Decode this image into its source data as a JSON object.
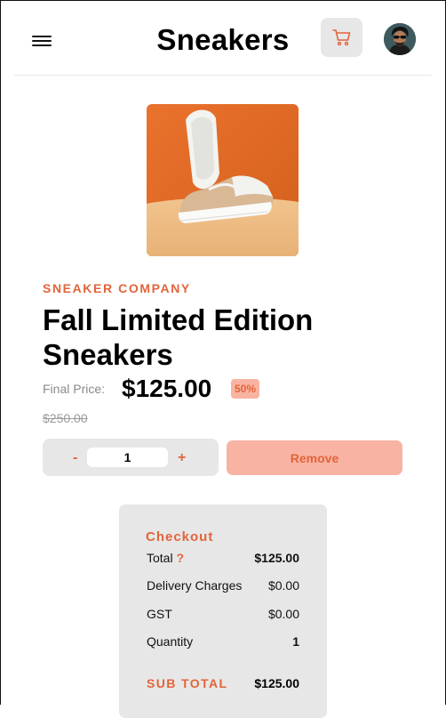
{
  "header": {
    "menu_icon": "hamburger-menu-icon",
    "brand": "Sneakers",
    "cart_icon": "cart-icon",
    "avatar_icon": "user-avatar"
  },
  "colors": {
    "accent": "#e2643b",
    "accent_light": "#f9b3a3",
    "panel": "#e7e7e7"
  },
  "product": {
    "image_icon": "sneaker-product-image",
    "company": "SNEAKER COMPANY",
    "title": "Fall Limited Edition Sneakers",
    "final_label": "Final Price:",
    "price": "$125.00",
    "discount": "50%",
    "original_price": "$250.00",
    "quantity": "1",
    "minus_label": "-",
    "plus_label": "+",
    "remove_label": "Remove"
  },
  "checkout": {
    "title": "Checkout",
    "total_label": "Total",
    "total_info": "?",
    "total_value": "$125.00",
    "delivery_label": "Delivery Charges",
    "delivery_value": "$0.00",
    "gst_label": "GST",
    "gst_value": "$0.00",
    "quantity_label": "Quantity",
    "quantity_value": "1",
    "subtotal_label": "SUB TOTAL",
    "subtotal_value": "$125.00"
  }
}
